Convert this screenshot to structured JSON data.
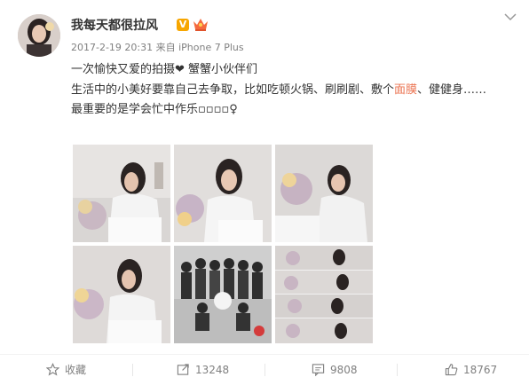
{
  "post": {
    "username": "我每天都很拉风",
    "verified_badge": "V",
    "meta": "2017-2-19 20:31 来自 iPhone 7 Plus",
    "line1": "一次愉快又爱的拍摄❤ 蟹蟹小伙伴们",
    "line2_pre": "生活中的小美好要靠自己去争取，比如吃顿火锅、刷刷剧、敷个",
    "line2_highlight": "面膜",
    "line2_post": "、健健身……",
    "line3": "最重要的是学会忙中作乐▫▫▫▫♀"
  },
  "actions": {
    "favorite_label": "收藏",
    "repost_count": "13248",
    "comment_count": "9808",
    "like_count": "18767"
  },
  "colors": {
    "highlight": "#eb7350",
    "verified": "#f7a600",
    "meta_gray": "#808080"
  },
  "icons": [
    "chevron-down-icon",
    "crown-icon",
    "star-icon",
    "repost-icon",
    "comment-icon",
    "like-icon"
  ]
}
